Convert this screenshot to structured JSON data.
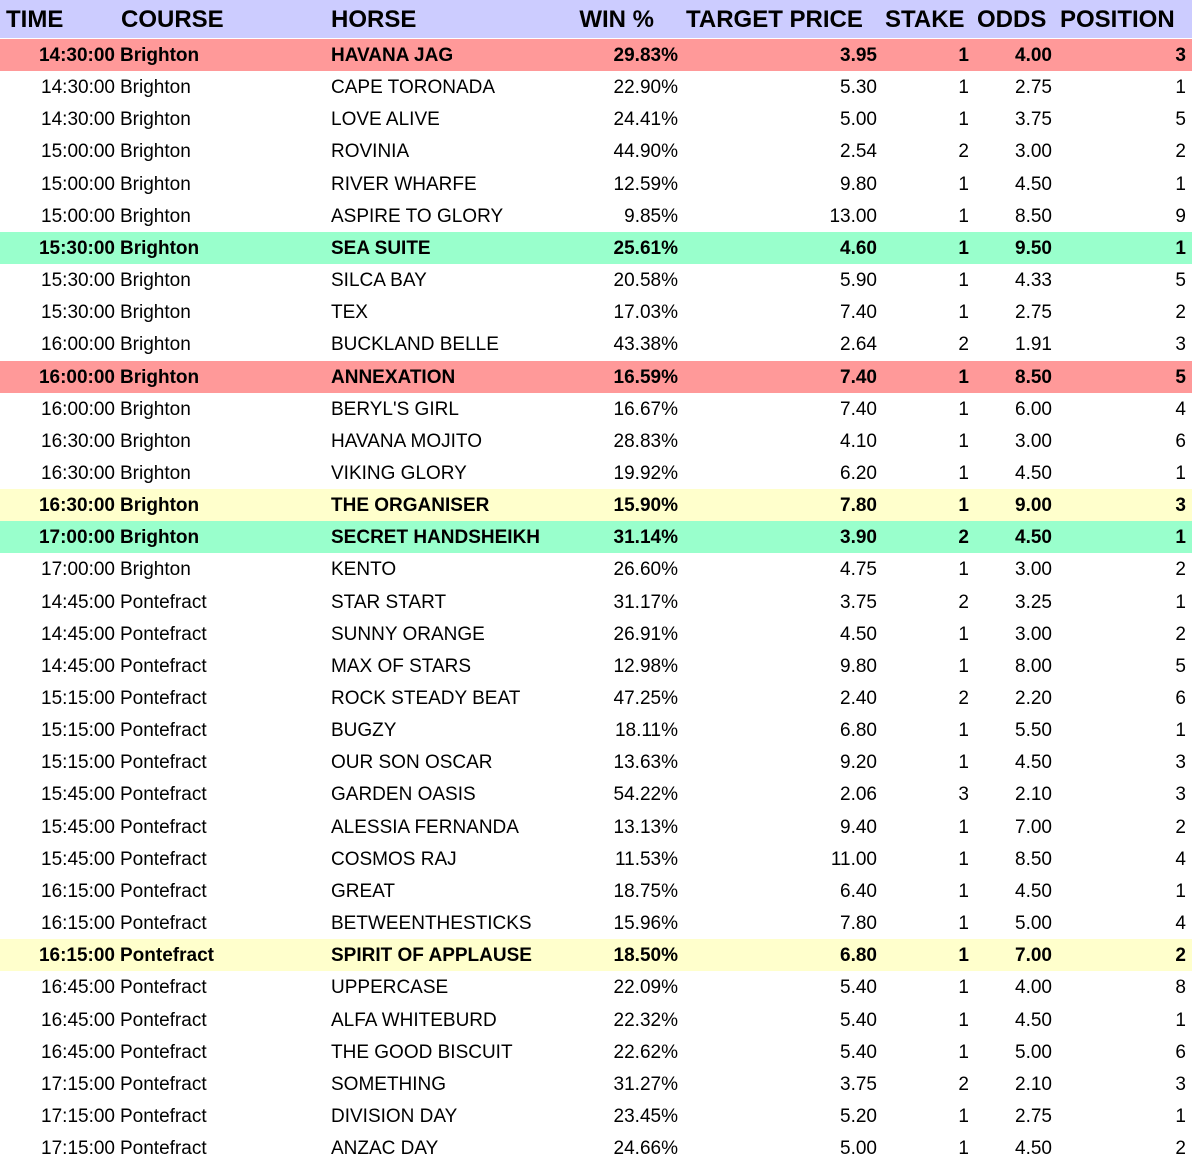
{
  "columns": {
    "time": "TIME",
    "course": "COURSE",
    "horse": "HORSE",
    "win": "WIN %",
    "target": "TARGET PRICE",
    "stake": "STAKE",
    "odds": "ODDS",
    "position": "POSITION"
  },
  "highlight_colors": {
    "red": "#ff9999",
    "green": "#99ffcc",
    "yellow": "#ffffcc",
    "header": "#ccccff"
  },
  "rows": [
    {
      "time": "14:30:00",
      "course": "Brighton",
      "horse": "HAVANA JAG",
      "win": "29.83%",
      "target": "3.95",
      "stake": "1",
      "odds": "4.00",
      "position": "3",
      "highlight": "red"
    },
    {
      "time": "14:30:00",
      "course": "Brighton",
      "horse": "CAPE TORONADA",
      "win": "22.90%",
      "target": "5.30",
      "stake": "1",
      "odds": "2.75",
      "position": "1",
      "highlight": "none"
    },
    {
      "time": "14:30:00",
      "course": "Brighton",
      "horse": "LOVE ALIVE",
      "win": "24.41%",
      "target": "5.00",
      "stake": "1",
      "odds": "3.75",
      "position": "5",
      "highlight": "none"
    },
    {
      "time": "15:00:00",
      "course": "Brighton",
      "horse": "ROVINIA",
      "win": "44.90%",
      "target": "2.54",
      "stake": "2",
      "odds": "3.00",
      "position": "2",
      "highlight": "none"
    },
    {
      "time": "15:00:00",
      "course": "Brighton",
      "horse": "RIVER WHARFE",
      "win": "12.59%",
      "target": "9.80",
      "stake": "1",
      "odds": "4.50",
      "position": "1",
      "highlight": "none"
    },
    {
      "time": "15:00:00",
      "course": "Brighton",
      "horse": "ASPIRE TO GLORY",
      "win": "9.85%",
      "target": "13.00",
      "stake": "1",
      "odds": "8.50",
      "position": "9",
      "highlight": "none"
    },
    {
      "time": "15:30:00",
      "course": "Brighton",
      "horse": "SEA SUITE",
      "win": "25.61%",
      "target": "4.60",
      "stake": "1",
      "odds": "9.50",
      "position": "1",
      "highlight": "green"
    },
    {
      "time": "15:30:00",
      "course": "Brighton",
      "horse": "SILCA BAY",
      "win": "20.58%",
      "target": "5.90",
      "stake": "1",
      "odds": "4.33",
      "position": "5",
      "highlight": "none"
    },
    {
      "time": "15:30:00",
      "course": "Brighton",
      "horse": "TEX",
      "win": "17.03%",
      "target": "7.40",
      "stake": "1",
      "odds": "2.75",
      "position": "2",
      "highlight": "none"
    },
    {
      "time": "16:00:00",
      "course": "Brighton",
      "horse": "BUCKLAND BELLE",
      "win": "43.38%",
      "target": "2.64",
      "stake": "2",
      "odds": "1.91",
      "position": "3",
      "highlight": "none"
    },
    {
      "time": "16:00:00",
      "course": "Brighton",
      "horse": "ANNEXATION",
      "win": "16.59%",
      "target": "7.40",
      "stake": "1",
      "odds": "8.50",
      "position": "5",
      "highlight": "red"
    },
    {
      "time": "16:00:00",
      "course": "Brighton",
      "horse": "BERYL'S GIRL",
      "win": "16.67%",
      "target": "7.40",
      "stake": "1",
      "odds": "6.00",
      "position": "4",
      "highlight": "none"
    },
    {
      "time": "16:30:00",
      "course": "Brighton",
      "horse": "HAVANA MOJITO",
      "win": "28.83%",
      "target": "4.10",
      "stake": "1",
      "odds": "3.00",
      "position": "6",
      "highlight": "none"
    },
    {
      "time": "16:30:00",
      "course": "Brighton",
      "horse": "VIKING GLORY",
      "win": "19.92%",
      "target": "6.20",
      "stake": "1",
      "odds": "4.50",
      "position": "1",
      "highlight": "none"
    },
    {
      "time": "16:30:00",
      "course": "Brighton",
      "horse": "THE ORGANISER",
      "win": "15.90%",
      "target": "7.80",
      "stake": "1",
      "odds": "9.00",
      "position": "3",
      "highlight": "yellow"
    },
    {
      "time": "17:00:00",
      "course": "Brighton",
      "horse": "SECRET HANDSHEIKH",
      "win": "31.14%",
      "target": "3.90",
      "stake": "2",
      "odds": "4.50",
      "position": "1",
      "highlight": "green"
    },
    {
      "time": "17:00:00",
      "course": "Brighton",
      "horse": "KENTO",
      "win": "26.60%",
      "target": "4.75",
      "stake": "1",
      "odds": "3.00",
      "position": "2",
      "highlight": "none"
    },
    {
      "time": "14:45:00",
      "course": "Pontefract",
      "horse": "STAR START",
      "win": "31.17%",
      "target": "3.75",
      "stake": "2",
      "odds": "3.25",
      "position": "1",
      "highlight": "none"
    },
    {
      "time": "14:45:00",
      "course": "Pontefract",
      "horse": "SUNNY ORANGE",
      "win": "26.91%",
      "target": "4.50",
      "stake": "1",
      "odds": "3.00",
      "position": "2",
      "highlight": "none"
    },
    {
      "time": "14:45:00",
      "course": "Pontefract",
      "horse": "MAX OF STARS",
      "win": "12.98%",
      "target": "9.80",
      "stake": "1",
      "odds": "8.00",
      "position": "5",
      "highlight": "none"
    },
    {
      "time": "15:15:00",
      "course": "Pontefract",
      "horse": "ROCK STEADY BEAT",
      "win": "47.25%",
      "target": "2.40",
      "stake": "2",
      "odds": "2.20",
      "position": "6",
      "highlight": "none"
    },
    {
      "time": "15:15:00",
      "course": "Pontefract",
      "horse": "BUGZY",
      "win": "18.11%",
      "target": "6.80",
      "stake": "1",
      "odds": "5.50",
      "position": "1",
      "highlight": "none"
    },
    {
      "time": "15:15:00",
      "course": "Pontefract",
      "horse": "OUR SON OSCAR",
      "win": "13.63%",
      "target": "9.20",
      "stake": "1",
      "odds": "4.50",
      "position": "3",
      "highlight": "none"
    },
    {
      "time": "15:45:00",
      "course": "Pontefract",
      "horse": "GARDEN OASIS",
      "win": "54.22%",
      "target": "2.06",
      "stake": "3",
      "odds": "2.10",
      "position": "3",
      "highlight": "none"
    },
    {
      "time": "15:45:00",
      "course": "Pontefract",
      "horse": "ALESSIA FERNANDA",
      "win": "13.13%",
      "target": "9.40",
      "stake": "1",
      "odds": "7.00",
      "position": "2",
      "highlight": "none"
    },
    {
      "time": "15:45:00",
      "course": "Pontefract",
      "horse": "COSMOS RAJ",
      "win": "11.53%",
      "target": "11.00",
      "stake": "1",
      "odds": "8.50",
      "position": "4",
      "highlight": "none"
    },
    {
      "time": "16:15:00",
      "course": "Pontefract",
      "horse": "GREAT",
      "win": "18.75%",
      "target": "6.40",
      "stake": "1",
      "odds": "4.50",
      "position": "1",
      "highlight": "none"
    },
    {
      "time": "16:15:00",
      "course": "Pontefract",
      "horse": "BETWEENTHESTICKS",
      "win": "15.96%",
      "target": "7.80",
      "stake": "1",
      "odds": "5.00",
      "position": "4",
      "highlight": "none"
    },
    {
      "time": "16:15:00",
      "course": "Pontefract",
      "horse": "SPIRIT OF APPLAUSE",
      "win": "18.50%",
      "target": "6.80",
      "stake": "1",
      "odds": "7.00",
      "position": "2",
      "highlight": "yellow"
    },
    {
      "time": "16:45:00",
      "course": "Pontefract",
      "horse": "UPPERCASE",
      "win": "22.09%",
      "target": "5.40",
      "stake": "1",
      "odds": "4.00",
      "position": "8",
      "highlight": "none"
    },
    {
      "time": "16:45:00",
      "course": "Pontefract",
      "horse": "ALFA WHITEBURD",
      "win": "22.32%",
      "target": "5.40",
      "stake": "1",
      "odds": "4.50",
      "position": "1",
      "highlight": "none"
    },
    {
      "time": "16:45:00",
      "course": "Pontefract",
      "horse": "THE GOOD BISCUIT",
      "win": "22.62%",
      "target": "5.40",
      "stake": "1",
      "odds": "5.00",
      "position": "6",
      "highlight": "none"
    },
    {
      "time": "17:15:00",
      "course": "Pontefract",
      "horse": "SOMETHING",
      "win": "31.27%",
      "target": "3.75",
      "stake": "2",
      "odds": "2.10",
      "position": "3",
      "highlight": "none"
    },
    {
      "time": "17:15:00",
      "course": "Pontefract",
      "horse": "DIVISION DAY",
      "win": "23.45%",
      "target": "5.20",
      "stake": "1",
      "odds": "2.75",
      "position": "1",
      "highlight": "none"
    },
    {
      "time": "17:15:00",
      "course": "Pontefract",
      "horse": "ANZAC DAY",
      "win": "24.66%",
      "target": "5.00",
      "stake": "1",
      "odds": "4.50",
      "position": "2",
      "highlight": "none"
    }
  ]
}
